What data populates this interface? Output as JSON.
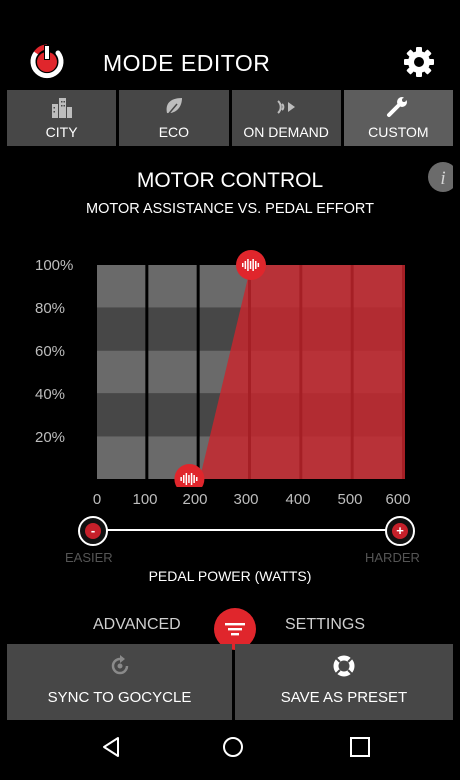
{
  "header": {
    "title": "MODE EDITOR",
    "icons": {
      "left": "power-icon",
      "right": "gear-icon"
    }
  },
  "tabs": [
    {
      "label": "CITY",
      "icon": "city-icon",
      "active": false
    },
    {
      "label": "ECO",
      "icon": "leaf-icon",
      "active": false
    },
    {
      "label": "ON DEMAND",
      "icon": "on-demand-icon",
      "active": false
    },
    {
      "label": "CUSTOM",
      "icon": "wrench-icon",
      "active": true
    }
  ],
  "section": {
    "title": "MOTOR CONTROL",
    "subtitle": "MOTOR ASSISTANCE VS. PEDAL EFFORT",
    "info_icon": "info-icon"
  },
  "chart_data": {
    "type": "area",
    "y_ticks": [
      "100%",
      "80%",
      "60%",
      "40%",
      "20%"
    ],
    "x_ticks": [
      "0",
      "100",
      "200",
      "300",
      "400",
      "500",
      "600"
    ],
    "xlim": [
      0,
      600
    ],
    "ylim": [
      0,
      100
    ],
    "series": [
      {
        "x": [
          200,
          300,
          600,
          600
        ],
        "y": [
          0,
          100,
          100,
          0
        ]
      }
    ],
    "handles": [
      {
        "x": 300,
        "y": 100
      },
      {
        "x": 180,
        "y": 0
      }
    ],
    "xlabel": "PEDAL POWER (WATTS)",
    "colors": {
      "assist": "#c9262d",
      "grid_light": "#6a6a6a",
      "grid_dark": "#474747"
    }
  },
  "slider": {
    "left_label": "EASIER",
    "right_label": "HARDER",
    "minus": "-",
    "plus": "+"
  },
  "advanced": {
    "left": "ADVANCED",
    "right": "SETTINGS",
    "icon": "filter-icon"
  },
  "buttons": [
    {
      "label": "SYNC TO GOCYCLE",
      "icon": "sync-icon"
    },
    {
      "label": "SAVE AS PRESET",
      "icon": "lifebuoy-icon"
    }
  ],
  "nav": {
    "back": "back-icon",
    "home": "home-icon",
    "recents": "recents-icon"
  },
  "accent": "#e0262c"
}
